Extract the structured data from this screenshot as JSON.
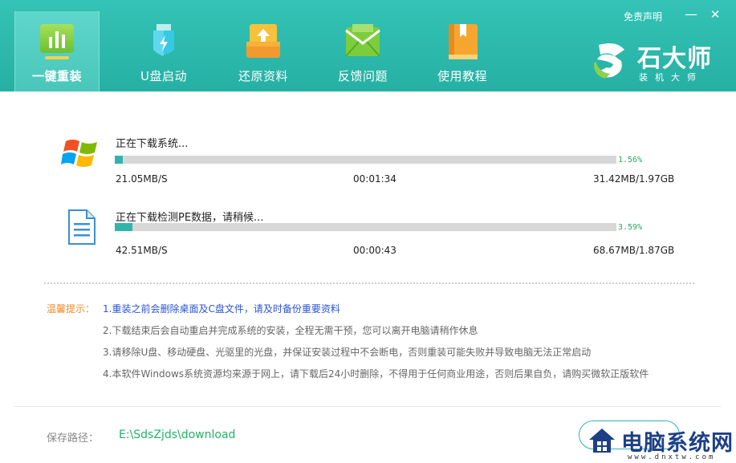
{
  "nav": {
    "items": [
      {
        "label": "一键重装",
        "icon": "bar-chart-icon"
      },
      {
        "label": "U盘启动",
        "icon": "usb-drive-icon"
      },
      {
        "label": "还原资料",
        "icon": "restore-box-icon"
      },
      {
        "label": "反馈问题",
        "icon": "mail-envelope-icon"
      },
      {
        "label": "使用教程",
        "icon": "book-icon"
      }
    ],
    "active_index": 0
  },
  "header": {
    "disclaimer": "免责声明",
    "minimize": "—",
    "close": "✕"
  },
  "brand": {
    "name": "石大师",
    "sub": "装机大师"
  },
  "downloads": [
    {
      "title": "正在下载系统...",
      "progress_pct": 1.56,
      "progress_text": "1.56%",
      "speed": "21.05MB/S",
      "time": "00:01:34",
      "size": "31.42MB/1.97GB",
      "icon": "windows-logo-icon"
    },
    {
      "title": "正在下载检测PE数据，请稍候...",
      "progress_pct": 3.59,
      "progress_text": "3.59%",
      "speed": "42.51MB/S",
      "time": "00:00:43",
      "size": "68.67MB/1.87GB",
      "icon": "document-icon"
    }
  ],
  "tips": {
    "label": "温馨提示：",
    "items": [
      "1.重装之前会删除桌面及C盘文件，请及时备份重要资料",
      "2.下载结束后会自动重启并完成系统的安装，全程无需干预，您可以离开电脑请稍作休息",
      "3.请移除U盘、移动硬盘、光驱里的光盘，并保证安装过程中不会断电，否则重装可能失败并导致电脑无法正常启动",
      "4.本软件Windows系统资源均来源于网上，请下载后24小时删除，不得用于任何商业用途，否则后果自负，请购买微软正版软件"
    ]
  },
  "footer": {
    "save_label": "保存路径：",
    "save_path": "E:\\SdsZjds\\download"
  },
  "watermark": {
    "text": "电脑系统网",
    "url": "www.dnxtw.com"
  },
  "colors": {
    "header": "#2bb8ab",
    "progress": "#2fb5ac",
    "percent": "#22aa60",
    "tip_highlight": "#2a55d4",
    "tip_label": "#f08a24",
    "path": "#22b266"
  }
}
